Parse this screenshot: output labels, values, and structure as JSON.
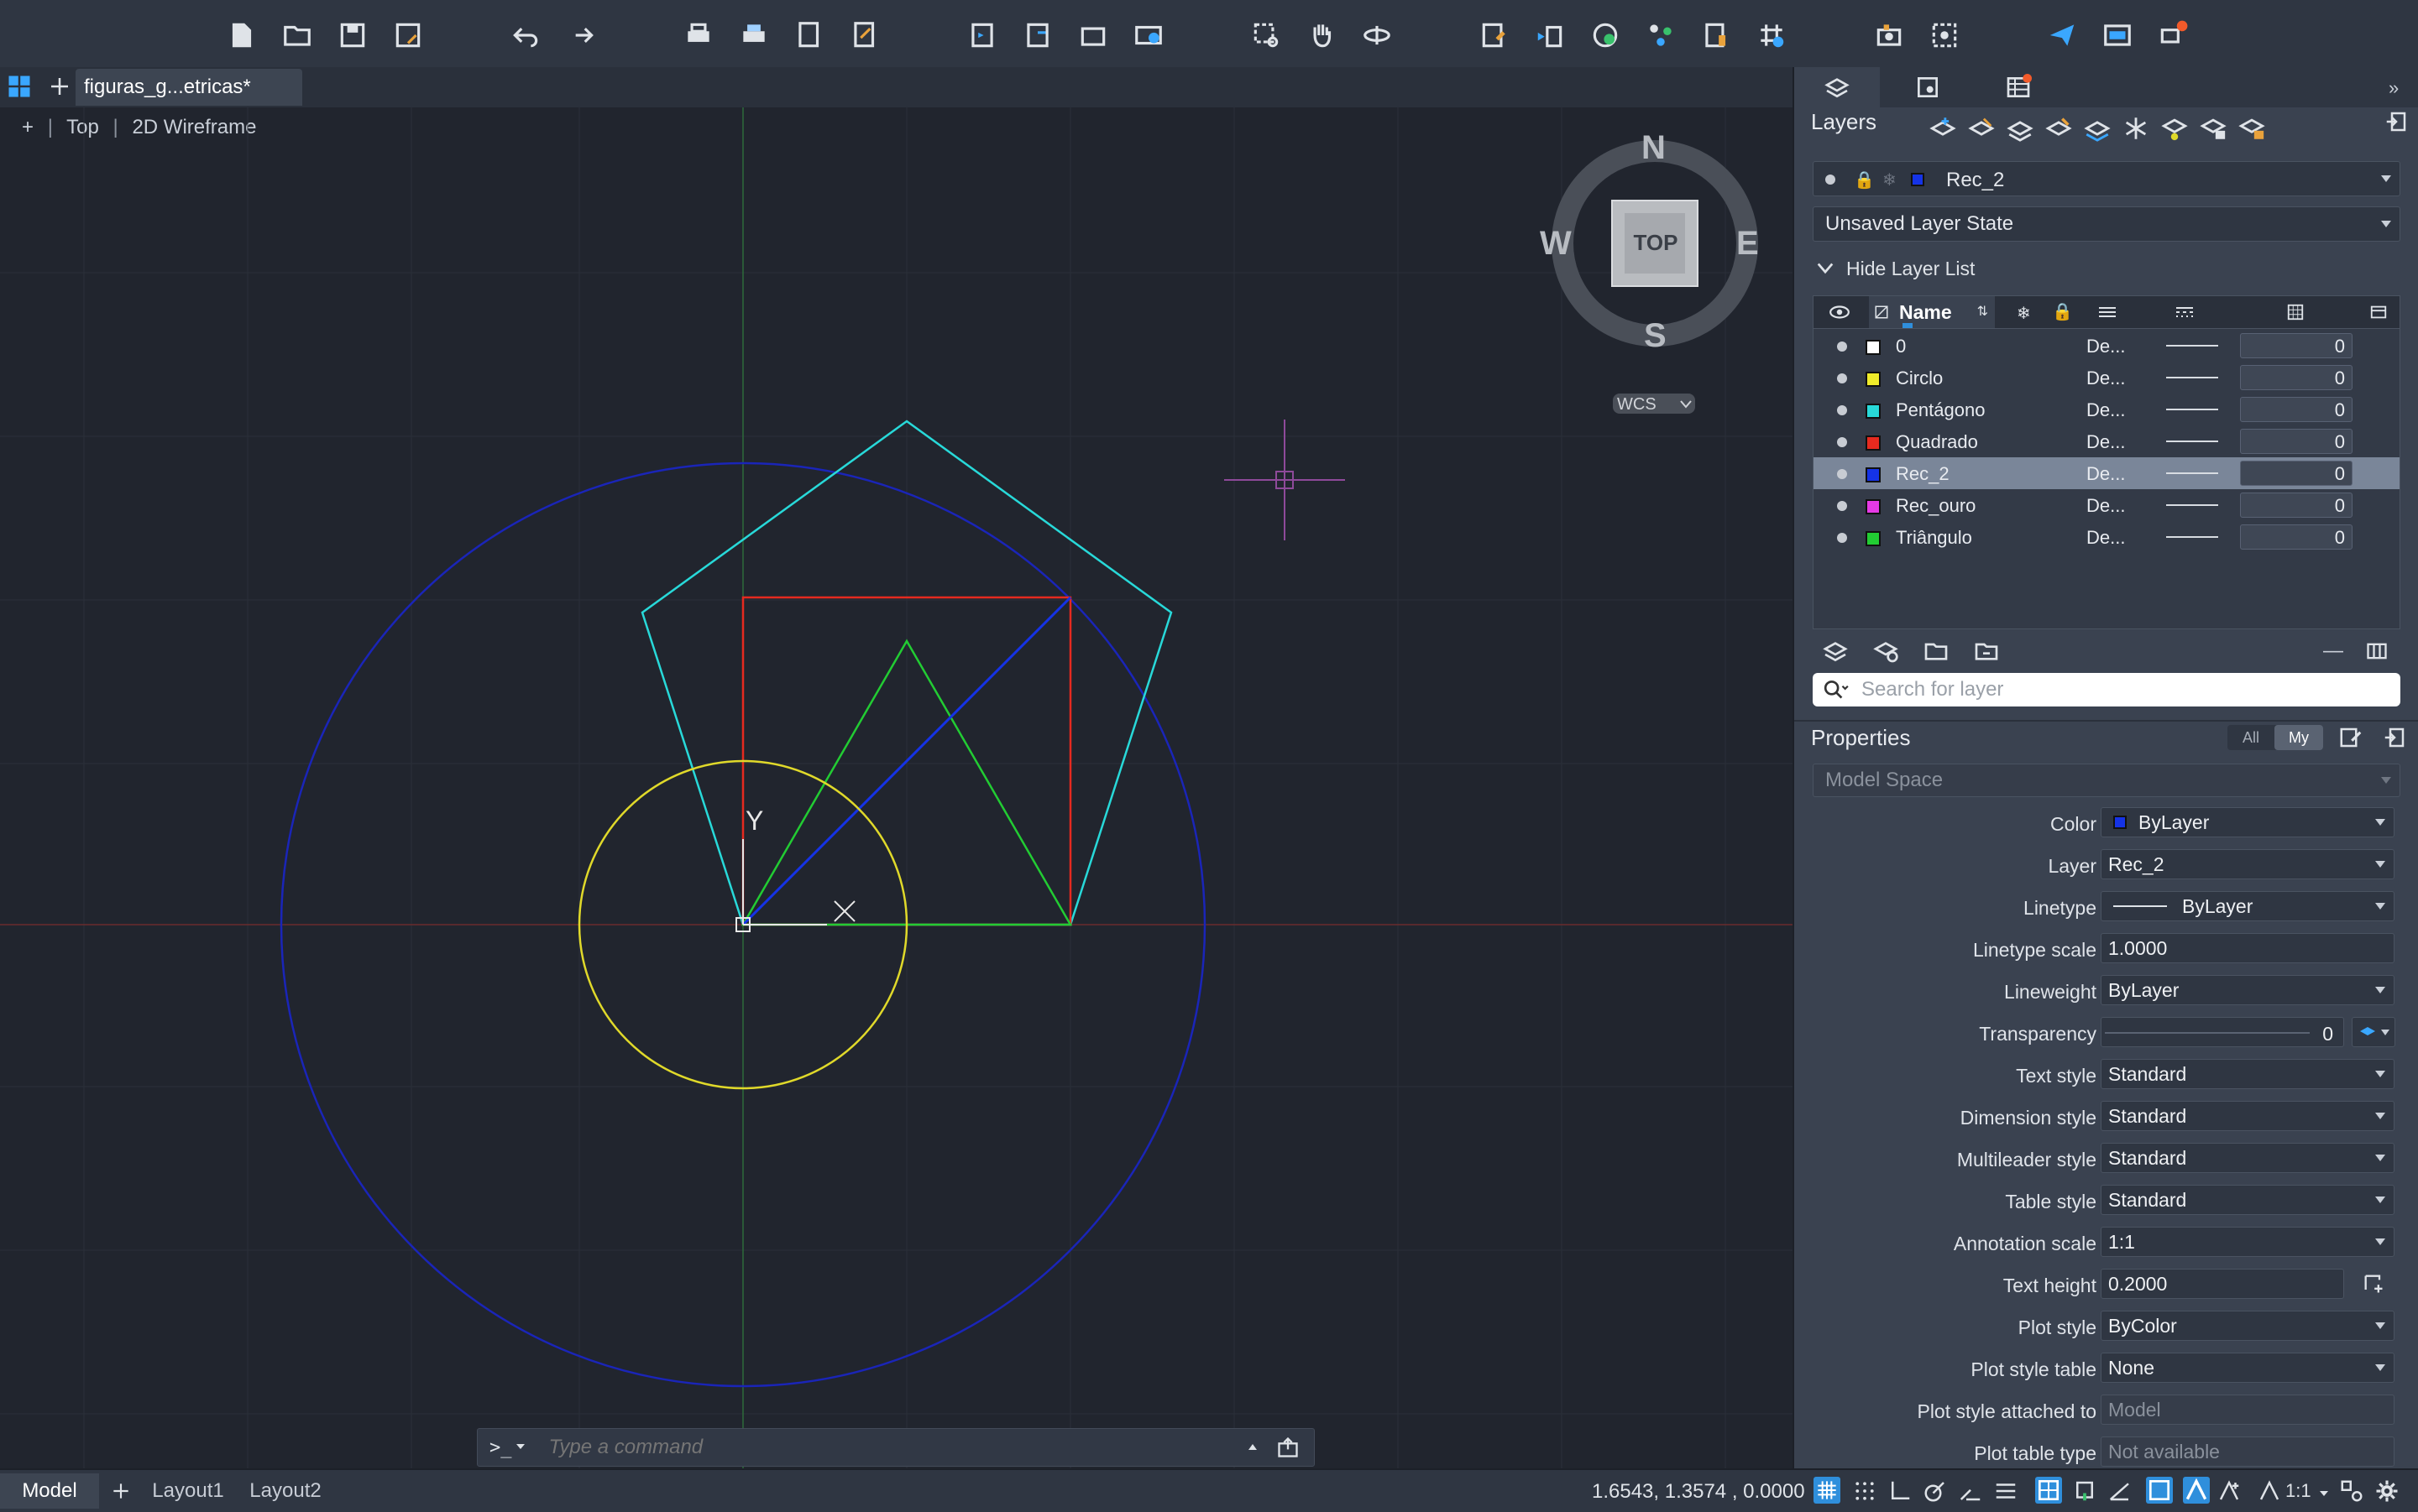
{
  "document_tab": {
    "label": "figuras_g...etricas*"
  },
  "viewport": {
    "plus": "+",
    "view": "Top",
    "visual_style": "2D Wireframe"
  },
  "viewcube": {
    "n": "N",
    "s": "S",
    "e": "E",
    "w": "W",
    "face": "TOP",
    "wcs": "WCS"
  },
  "ucs": {
    "y": "Y"
  },
  "command": {
    "prompt": ">_",
    "placeholder": "Type a command"
  },
  "status": {
    "tabs": [
      "Model",
      "Layout1",
      "Layout2"
    ],
    "coords": "1.6543,  1.3574 , 0.0000",
    "scale": "1:1"
  },
  "layers_panel": {
    "title": "Layers",
    "current_layer": "Rec_2",
    "current_layer_color": "#1533e6",
    "layer_state": "Unsaved Layer State",
    "hide_list": "Hide Layer List",
    "name_header": "Name",
    "search_placeholder": "Search for layer",
    "rows": [
      {
        "name": "0",
        "color": "#ffffff",
        "linetype": "De...",
        "transparency": "0",
        "selected": false
      },
      {
        "name": "Circlo",
        "color": "#f0ec2a",
        "linetype": "De...",
        "transparency": "0",
        "selected": false
      },
      {
        "name": "Pentágono",
        "color": "#28d9d9",
        "linetype": "De...",
        "transparency": "0",
        "selected": false
      },
      {
        "name": "Quadrado",
        "color": "#e62a1f",
        "linetype": "De...",
        "transparency": "0",
        "selected": false
      },
      {
        "name": "Rec_2",
        "color": "#1533e6",
        "linetype": "De...",
        "transparency": "0",
        "selected": true
      },
      {
        "name": "Rec_ouro",
        "color": "#e63ae6",
        "linetype": "De...",
        "transparency": "0",
        "selected": false
      },
      {
        "name": "Triângulo",
        "color": "#22cc33",
        "linetype": "De...",
        "transparency": "0",
        "selected": false
      }
    ]
  },
  "properties_panel": {
    "title": "Properties",
    "all": "All",
    "my": "My",
    "context": "Model Space",
    "rows": [
      {
        "label": "Color",
        "value": "ByLayer",
        "type": "dropdown",
        "swatch": "#1533e6"
      },
      {
        "label": "Layer",
        "value": "Rec_2",
        "type": "dropdown"
      },
      {
        "label": "Linetype",
        "value": "ByLayer",
        "type": "dropdown",
        "line": true
      },
      {
        "label": "Linetype scale",
        "value": "1.0000",
        "type": "text"
      },
      {
        "label": "Lineweight",
        "value": "ByLayer",
        "type": "dropdown"
      },
      {
        "label": "Transparency",
        "value": "0",
        "type": "slider"
      },
      {
        "label": "Text style",
        "value": "Standard",
        "type": "dropdown"
      },
      {
        "label": "Dimension style",
        "value": "Standard",
        "type": "dropdown"
      },
      {
        "label": "Multileader style",
        "value": "Standard",
        "type": "dropdown"
      },
      {
        "label": "Table style",
        "value": "Standard",
        "type": "dropdown"
      },
      {
        "label": "Annotation scale",
        "value": "1:1",
        "type": "dropdown"
      },
      {
        "label": "Text height",
        "value": "0.2000",
        "type": "text"
      },
      {
        "label": "Plot style",
        "value": "ByColor",
        "type": "dropdown"
      },
      {
        "label": "Plot style table",
        "value": "None",
        "type": "dropdown"
      },
      {
        "label": "Plot style attached to",
        "value": "Model",
        "type": "disabled"
      },
      {
        "label": "Plot table type",
        "value": "Not available",
        "type": "disabled"
      }
    ]
  },
  "colors": {
    "circle_large": "#1a25b8",
    "pentagon": "#28d9d9",
    "square": "#e62a1f",
    "triangle": "#22cc33",
    "circle_small": "#e0d92a",
    "diagonal": "#1533e6",
    "accent": "#2f8fdc"
  }
}
